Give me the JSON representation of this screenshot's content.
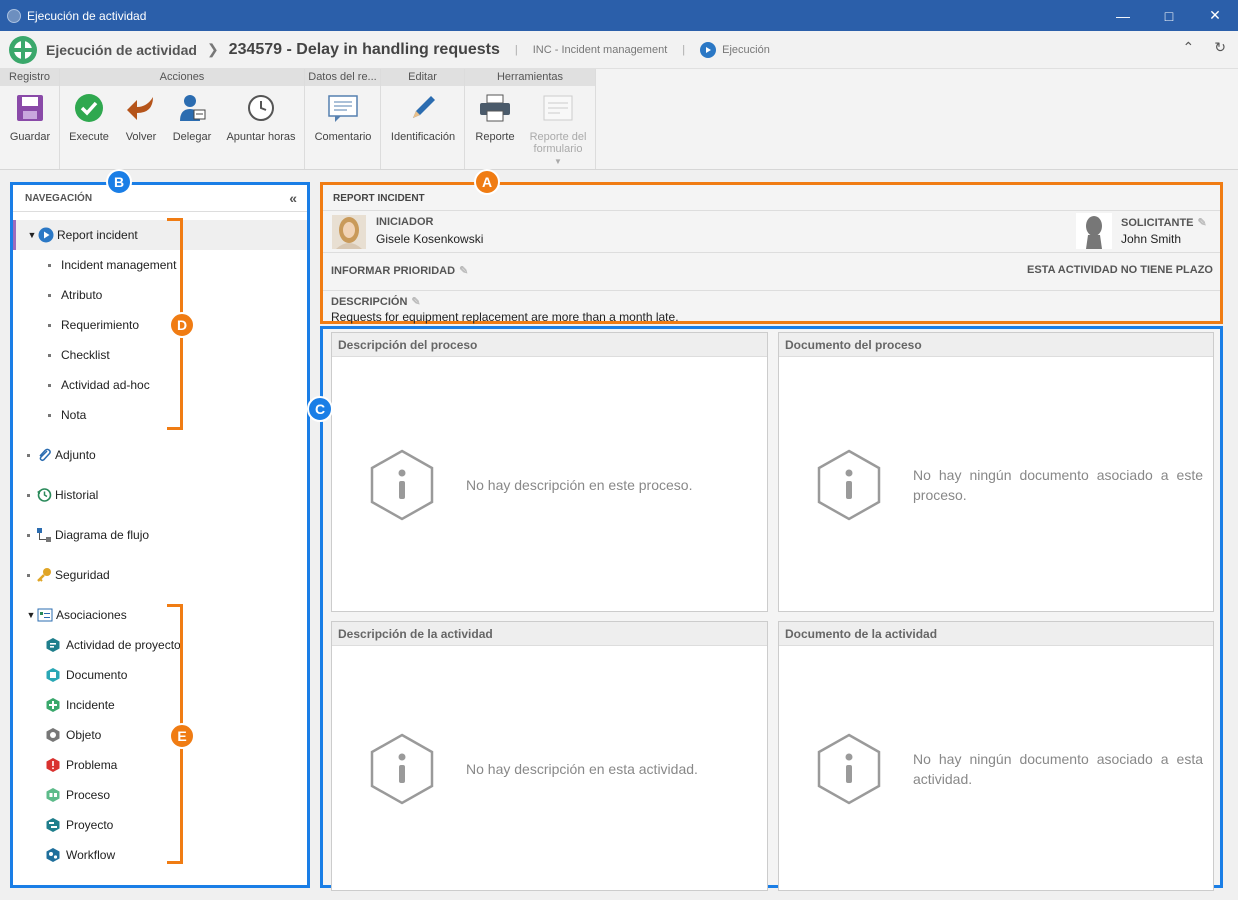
{
  "window": {
    "title": "Ejecución de actividad"
  },
  "header": {
    "breadcrumb_root": "Ejecución de actividad",
    "breadcrumb_current": "234579 - Delay in handling requests",
    "process": "INC - Incident management",
    "status": "Ejecución"
  },
  "ribbon": {
    "groups": {
      "registro": "Registro",
      "acciones": "Acciones",
      "datos": "Datos del re...",
      "editar": "Editar",
      "herramientas": "Herramientas"
    },
    "buttons": {
      "guardar": "Guardar",
      "execute": "Execute",
      "volver": "Volver",
      "delegar": "Delegar",
      "apuntar_horas": "Apuntar horas",
      "comentario": "Comentario",
      "identificacion": "Identificación",
      "reporte": "Reporte",
      "reporte_formulario_1": "Reporte del",
      "reporte_formulario_2": "formulario"
    }
  },
  "navigation": {
    "title": "NAVEGACIÓN",
    "items": [
      {
        "label": "Report incident"
      },
      {
        "label": "Incident management"
      },
      {
        "label": "Atributo"
      },
      {
        "label": "Requerimiento"
      },
      {
        "label": "Checklist"
      },
      {
        "label": "Actividad ad-hoc"
      },
      {
        "label": "Nota"
      },
      {
        "label": "Adjunto"
      },
      {
        "label": "Historial"
      },
      {
        "label": "Diagrama de flujo"
      },
      {
        "label": "Seguridad"
      },
      {
        "label": "Asociaciones"
      },
      {
        "label": "Actividad de proyecto"
      },
      {
        "label": "Documento"
      },
      {
        "label": "Incidente"
      },
      {
        "label": "Objeto"
      },
      {
        "label": "Problema"
      },
      {
        "label": "Proceso"
      },
      {
        "label": "Proyecto"
      },
      {
        "label": "Workflow"
      }
    ]
  },
  "activity": {
    "title": "REPORT INCIDENT",
    "initiator_label": "INICIADOR",
    "initiator_name": "Gisele Kosenkowski",
    "requester_label": "SOLICITANTE",
    "requester_name": "John Smith",
    "priority_label": "INFORMAR PRIORIDAD",
    "deadline_text": "ESTA ACTIVIDAD NO TIENE PLAZO",
    "description_label": "DESCRIPCIÓN",
    "description_text": "Requests for equipment replacement are more than a month late."
  },
  "cards": {
    "process_desc": {
      "title": "Descripción del proceso",
      "message": "No hay descripción en este proceso."
    },
    "process_doc": {
      "title": "Documento del proceso",
      "message": "No hay ningún documento asociado a este proceso."
    },
    "activity_desc": {
      "title": "Descripción de la actividad",
      "message": "No hay descripción en esta actividad."
    },
    "activity_doc": {
      "title": "Documento de la actividad",
      "message": "No hay ningún documento asociado a esta actividad."
    }
  },
  "callouts": {
    "a": "A",
    "b": "B",
    "c": "C",
    "d": "D",
    "e": "E"
  },
  "colors": {
    "titlebar": "#2b5faa",
    "callout_orange": "#f07c13",
    "callout_blue": "#1a7ee6",
    "active_nav_marker": "#9c6bbd"
  }
}
